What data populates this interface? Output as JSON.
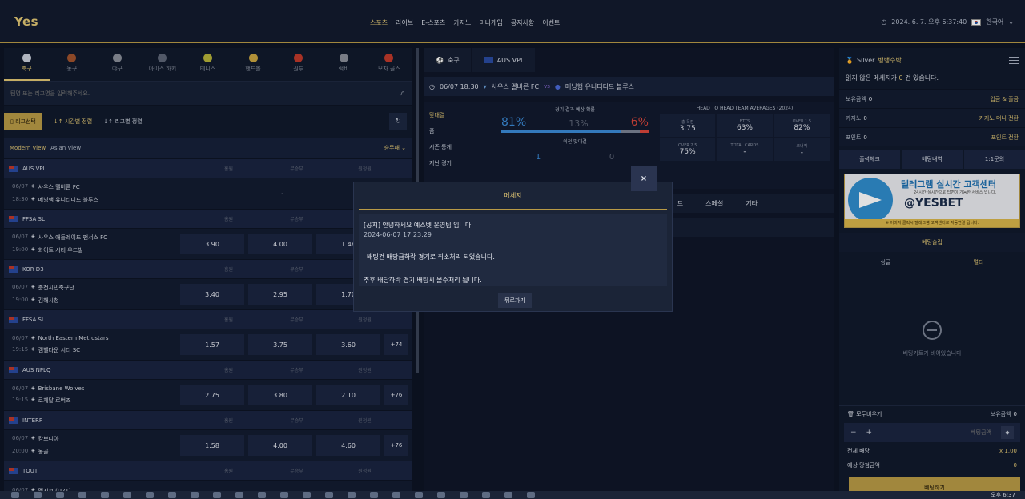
{
  "header": {
    "logo": "Yes",
    "nav": [
      "스포츠",
      "라이브",
      "E-스포츠",
      "카지노",
      "미니게임",
      "공지사항",
      "이벤트"
    ],
    "datetime": "2024. 6. 7. 오후 6:37:40",
    "language": "한국어"
  },
  "sports": [
    {
      "label": "축구",
      "color": "#c9cfda"
    },
    {
      "label": "농구",
      "color": "#a0522d"
    },
    {
      "label": "야구",
      "color": "#8a8f99"
    },
    {
      "label": "아이스 하키",
      "color": "#5e6677"
    },
    {
      "label": "테니스",
      "color": "#b5b23a"
    },
    {
      "label": "핸드볼",
      "color": "#c9a440"
    },
    {
      "label": "권투",
      "color": "#c0392b"
    },
    {
      "label": "럭비",
      "color": "#8a8f99"
    },
    {
      "label": "모자 골스",
      "color": "#c0392b"
    }
  ],
  "search": {
    "placeholder": "팀명 또는 리그명을 입력해주세요."
  },
  "filters": {
    "league_select": "리그선택",
    "time_sort": "시간별 정렬",
    "league_sort": "리그별 정렬"
  },
  "view": {
    "modern": "Modern View",
    "asian": "Asian View",
    "market": "승무패"
  },
  "cols": {
    "home": "홈원",
    "draw": "무승부",
    "away": "원정원"
  },
  "leagues": [
    {
      "name": "AUS VPL",
      "match": {
        "date": "06/07",
        "time": "18:30",
        "home": "사우스 멜버른 FC",
        "away": "메닝햄 유니티디드 블루스",
        "odds": [],
        "more": ""
      }
    },
    {
      "name": "FFSA SL",
      "match": {
        "date": "06/07",
        "time": "19:00",
        "home": "사우스 애들레이드 팬서스 FC",
        "away": "화이트 시티 우드빌",
        "odds": [
          "3.90",
          "4.00",
          "1.48"
        ],
        "more": ""
      }
    },
    {
      "name": "KOR D3",
      "match": {
        "date": "06/07",
        "time": "19:00",
        "home": "춘천시민축구단",
        "away": "김해시청",
        "odds": [
          "3.40",
          "2.95",
          "1.70"
        ],
        "more": ""
      }
    },
    {
      "name": "FFSA SL",
      "match": {
        "date": "06/07",
        "time": "19:15",
        "home": "North Eastern Metrostars",
        "away": "캠벨타운 시티 SC",
        "odds": [
          "1.57",
          "3.75",
          "3.60"
        ],
        "more": "+74"
      }
    },
    {
      "name": "AUS NPLQ",
      "match": {
        "date": "06/07",
        "time": "19:15",
        "home": "Brisbane Wolves",
        "away": "로체달 로버즈",
        "odds": [
          "2.75",
          "3.80",
          "2.10"
        ],
        "more": "+76"
      }
    },
    {
      "name": "INTERF",
      "match": {
        "date": "06/07",
        "time": "20:00",
        "home": "캄보디아",
        "away": "몽골",
        "odds": [
          "1.58",
          "4.00",
          "4.60"
        ],
        "more": "+76"
      }
    },
    {
      "name": "TOUT",
      "match": {
        "date": "06/07",
        "time": "",
        "home": "멕시코 (U21)",
        "away": "",
        "odds": [],
        "more": ""
      }
    }
  ],
  "center": {
    "tabs": [
      "축구",
      "AUS VPL"
    ],
    "match_head": {
      "datetime": "06/07 18:30",
      "home": "사우스 멜버른 FC",
      "vs": "vs",
      "away": "메닝햄 유니티디드 블루스"
    },
    "side_nav": [
      "맞대결",
      "폼",
      "시즌 통계",
      "지난 경기"
    ],
    "prob_title": "경기 결과 예상 확률",
    "prob": {
      "home": "81%",
      "draw": "13%",
      "away": "6%"
    },
    "past_title": "이전 맞대결",
    "past": {
      "home": "1",
      "draw": "0"
    },
    "h2h_title": "HEAD TO HEAD TEAM AVERAGES (2024)",
    "h2h": [
      {
        "k": "총 득점",
        "v": "3.75"
      },
      {
        "k": "BTTS",
        "v": "63%"
      },
      {
        "k": "OVER 1.5",
        "v": "82%"
      },
      {
        "k": "OVER 2.5",
        "v": "75%"
      },
      {
        "k": "TOTAL CARDS",
        "v": "-"
      },
      {
        "k": "코너킥",
        "v": "-"
      }
    ],
    "market_tabs": [
      "드",
      "스페셜",
      "기타"
    ]
  },
  "right": {
    "level": "Silver",
    "level_name": "뱅뱅수박",
    "unread_pre": "읽지 않은 메세지가",
    "unread_count": "0",
    "unread_post": "건 있습니다.",
    "balances": [
      {
        "label": "보유금액",
        "value": "0",
        "action": "입금 & 출금"
      },
      {
        "label": "카지노",
        "value": "0",
        "action": "카지노 머니 전환"
      },
      {
        "label": "포인트",
        "value": "0",
        "action": "포인트 전환"
      }
    ],
    "buttons": [
      "출석체크",
      "베팅내역",
      "1:1문의"
    ],
    "banner": {
      "t1": "텔레그램 실시간 고객센터",
      "t2": "24시간 실시간으로 답변이 가능한 서비스 입니다.",
      "t3": "@YESBET",
      "t4": "※ 이미지 클릭시 텔레그램 고객센터로 자동연결 됩니다."
    },
    "slip_title": "베팅슬립",
    "slip_tabs": [
      "싱글",
      "멀티"
    ],
    "slip_empty": "베팅카트가 비어있습니다",
    "clear_all": "모두비우기",
    "hold_label": "보유금액",
    "hold_value": "0",
    "amount_placeholder": "베팅금액",
    "total_odds_label": "전체 배당",
    "total_odds": "x 1.00",
    "expected_label": "예상 당첨금액",
    "expected": "0",
    "bet_button": "베팅하기"
  },
  "modal": {
    "title": "메세지",
    "notice": "[공지] 안녕하세요 예스벳 운영팀 입니다.",
    "datetime": "2024-06-07 17:23:29",
    "line1": "배팅건 배당금하락 경기로 취소처리 되었습니다.",
    "line2": "추후 배당하락 경기 배팅시 몰수처리 됩니다.",
    "back": "뒤로가기",
    "close": "×"
  },
  "taskbar": {
    "time": "오후 6:37"
  }
}
